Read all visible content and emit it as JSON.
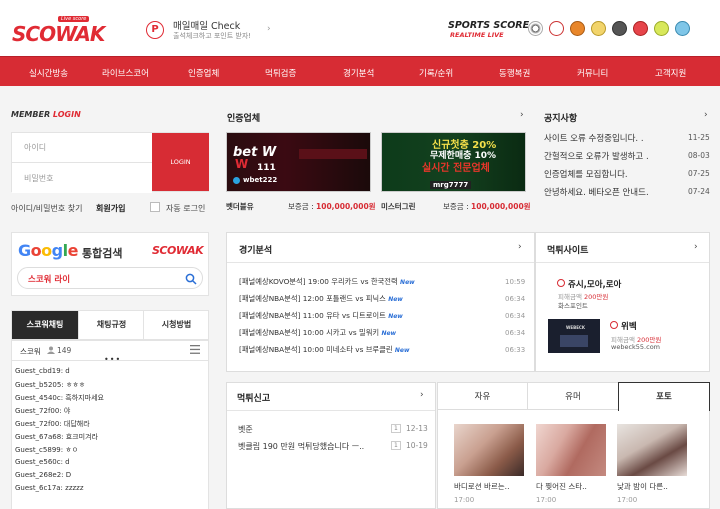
{
  "header": {
    "logo": "SCOWAK",
    "logo_sub": "Live score",
    "check_title": "매일매일 Check",
    "check_sub": "출석체크하고 포인트 받자!",
    "sports_score": "SPORTS SCORE",
    "realtime_live": "REALTIME LIVE",
    "sport_icons": [
      "soccer-icon",
      "baseball-icon",
      "basketball-icon",
      "volleyball-icon",
      "hockey-icon",
      "football-icon",
      "tennis-icon",
      "globe-icon"
    ]
  },
  "nav": [
    "실시간방송",
    "라이브스코어",
    "인증업체",
    "먹튀검증",
    "경기분석",
    "기록/순위",
    "동행복권",
    "커뮤니티",
    "고객지원"
  ],
  "login": {
    "title_1": "MEMBER",
    "title_2": "LOGIN",
    "id_placeholder": "아이디",
    "pw_placeholder": "비밀번호",
    "login_button": "LOGIN",
    "find": "아이디/비밀번호 찾기",
    "join": "회원가입",
    "auto": "자동 로그인"
  },
  "search": {
    "google": "Google",
    "label": "통합검색",
    "logo": "SCOWAK",
    "value": "스코워 라이"
  },
  "chat": {
    "tabs": [
      "스코워채팅",
      "채팅규정",
      "시청방법"
    ],
    "room": "스코워",
    "count": "149",
    "lines": [
      "Guest_cbd19: d",
      "Guest_b5205: ㅎㅎㅎ",
      "Guest_4540c: 흑하지마세요",
      "Guest_72f00: 야",
      "Guest_72f00: 대답해라",
      "Guest_67a68: 효크미겨라",
      "Guest_c5899: ㅎㅇ",
      "Guest_e560c: d",
      "Guest_268e2: D",
      "Guest_6c17a: zzzzz"
    ]
  },
  "cert": {
    "title": "인증업체",
    "items": [
      {
        "name": "벳더블유",
        "guarantee_label": "보증금 :",
        "guarantee": "100,000,000원",
        "banner_text": "bet W",
        "banner_num": "111",
        "banner_tg": "wbet222"
      },
      {
        "name": "미스터그린",
        "guarantee_label": "보증금 :",
        "guarantee": "100,000,000원",
        "banner_text": "신규첫충 20%",
        "banner_text2": "무제한매충 10%",
        "banner_text3": "실시간 전문업체",
        "banner_tg": "mrg7777"
      }
    ]
  },
  "notice": {
    "title": "공지사항",
    "items": [
      {
        "text": "사이트 오류 수정중입니다. .",
        "date": "11-25"
      },
      {
        "text": "간헐적으로 오류가 발생하고 .",
        "date": "08-03"
      },
      {
        "text": "인증업체를 모집합니다.",
        "date": "07-25"
      },
      {
        "text": "안녕하세요. 베타오픈 안내드.",
        "date": "07-24"
      }
    ]
  },
  "analysis": {
    "title": "경기분석",
    "new_label": "New",
    "items": [
      {
        "text": "[패널예상KOVO분석] 19:00 우리카드 vs 한국전력",
        "time": "10:59"
      },
      {
        "text": "[패널예상NBA분석] 12:00 포틀랜드 vs 피닉스",
        "time": "06:34"
      },
      {
        "text": "[패널예상NBA분석] 11:00 유타 vs 디트로이트",
        "time": "06:34"
      },
      {
        "text": "[패널예상NBA분석] 10:00 시카고 vs 밀워키",
        "time": "06:34"
      },
      {
        "text": "[패널예상NBA분석] 10:00 미네소타 vs 브루클린",
        "time": "06:33"
      }
    ]
  },
  "muktu_site": {
    "title": "먹튀사이트",
    "items": [
      {
        "name": "쥬시,모아,로아",
        "amount_label": "피해금액",
        "amount": "200만원",
        "domain": "화스포인트"
      },
      {
        "name": "위벡",
        "amount_label": "피해금액",
        "amount": "200만원",
        "domain": "webeck55.com",
        "thumb": "WEBECK"
      }
    ]
  },
  "report": {
    "title": "먹튀신고",
    "items": [
      {
        "text": "벳준",
        "count": "1",
        "date": "12-13"
      },
      {
        "text": "벳클립 190 만원 먹튀당했습니다 ㅡ..",
        "count": "1",
        "date": "10-19"
      }
    ]
  },
  "board_tabs": [
    "자유",
    "유머",
    "포토"
  ],
  "photos": [
    {
      "caption": "바디로션 바르는..",
      "time": "17:00"
    },
    {
      "caption": "다 찢어진 스타..",
      "time": "17:00"
    },
    {
      "caption": "낮과 밤이 다른..",
      "time": "17:00"
    }
  ],
  "colors": {
    "accent": "#d72c34",
    "new": "#2b6fd6"
  }
}
